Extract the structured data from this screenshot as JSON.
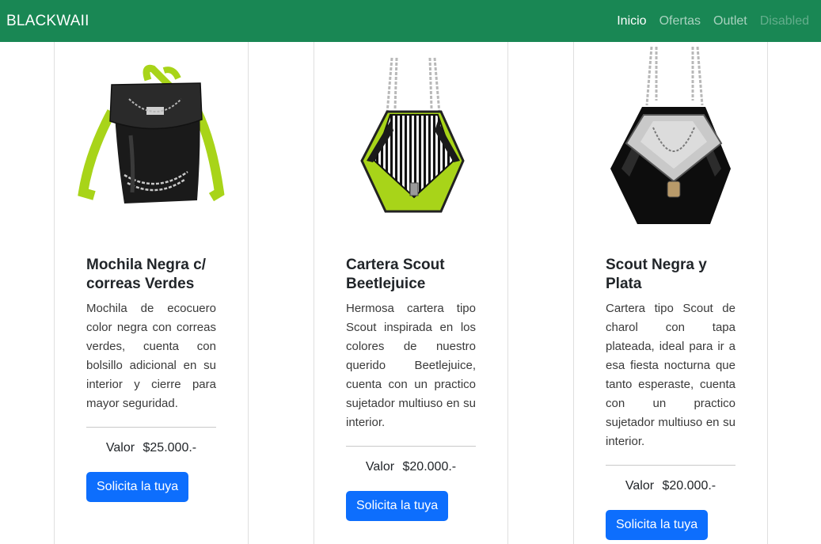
{
  "navbar": {
    "brand": "BLACKWAII",
    "links": [
      {
        "label": "Inicio",
        "state": "active"
      },
      {
        "label": "Ofertas",
        "state": "normal"
      },
      {
        "label": "Outlet",
        "state": "normal"
      },
      {
        "label": "Disabled",
        "state": "disabled"
      }
    ]
  },
  "colors": {
    "navbar_bg": "#198754",
    "button_bg": "#0d6efd",
    "accent_lime": "#a8d419"
  },
  "products": [
    {
      "title": "Mochila Negra c/ correas Verdes",
      "description": "Mochila de ecocuero color negra con correas verdes, cuenta con bolsillo adicional en su interior y cierre para mayor seguridad.",
      "price_label": "Valor",
      "price": "$25.000.-",
      "button": "Solicita la tuya",
      "image_icon": "backpack-image"
    },
    {
      "title": "Cartera Scout Beetlejuice",
      "description": "Hermosa cartera tipo Scout inspirada en los colores de nuestro querido Beetlejuice, cuenta con un practico sujetador multiuso en su interior.",
      "price_label": "Valor",
      "price": "$20.000.-",
      "button": "Solicita la tuya",
      "image_icon": "striped-bag-image"
    },
    {
      "title": "Scout Negra y Plata",
      "description": "Cartera tipo Scout de charol con tapa plateada, ideal para ir a esa fiesta nocturna que tanto esperaste, cuenta con un practico sujetador multiuso en su interior.",
      "price_label": "Valor",
      "price": "$20.000.-",
      "button": "Solicita la tuya",
      "image_icon": "silver-bag-image"
    }
  ]
}
